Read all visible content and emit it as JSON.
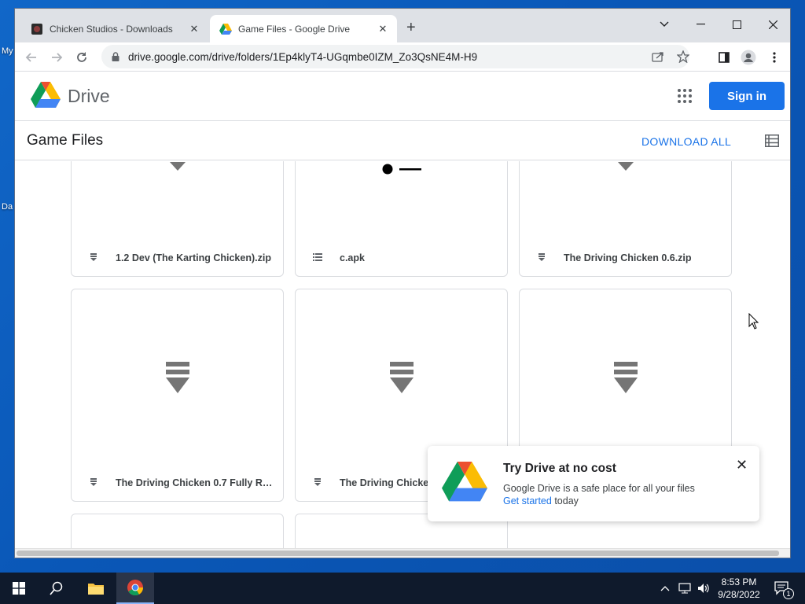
{
  "desktop": {
    "labels": [
      "My",
      "Da"
    ]
  },
  "browser": {
    "tabs": [
      {
        "title": "Chicken Studios - Downloads",
        "active": false
      },
      {
        "title": "Game Files - Google Drive",
        "active": true
      }
    ],
    "new_tab_symbol": "+",
    "url": "drive.google.com/drive/folders/1Ep4klyT4-UGqmbe0IZM_Zo3QsNE4M-H9"
  },
  "drive": {
    "brand": "Drive",
    "sign_in": "Sign in",
    "folder_title": "Game Files",
    "download_all": "DOWNLOAD ALL",
    "files": [
      {
        "name": "1.2 Dev (The Karting Chicken).zip",
        "icon": "zip-file-icon"
      },
      {
        "name": "c.apk",
        "icon": "list-file-icon"
      },
      {
        "name": "The Driving Chicken 0.6.zip",
        "icon": "zip-file-icon"
      },
      {
        "name": "The Driving Chicken 0.7 Fully Rel...",
        "icon": "zip-file-icon"
      },
      {
        "name": "The Driving Chicken 0.",
        "icon": "zip-file-icon"
      },
      {
        "name": "",
        "icon": "zip-file-icon"
      }
    ]
  },
  "promo": {
    "title": "Try Drive at no cost",
    "description": "Google Drive is a safe place for all your files",
    "link_text": "Get started",
    "link_suffix": "today"
  },
  "taskbar": {
    "time": "8:53 PM",
    "date": "9/28/2022",
    "notification_count": "1"
  },
  "colors": {
    "accent": "#1a73e8",
    "taskbar": "#0f1a2c",
    "desktop": "#0b5cbd"
  }
}
